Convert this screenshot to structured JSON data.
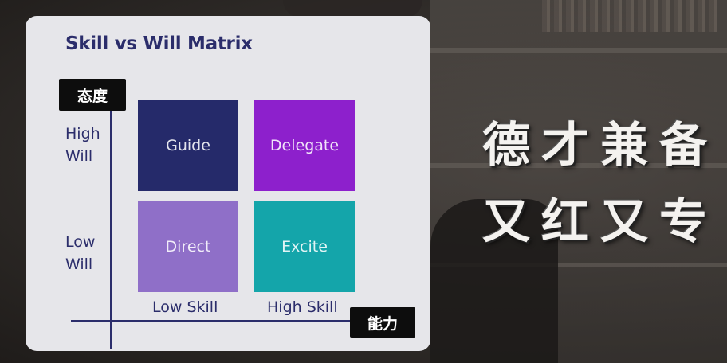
{
  "diagram": {
    "title": "Skill vs Will Matrix",
    "y_axis_tag": "态度",
    "x_axis_tag": "能力",
    "y_labels": {
      "high": "High\nWill",
      "low": "Low\nWill"
    },
    "x_labels": {
      "low": "Low Skill",
      "high": "High Skill"
    },
    "quadrants": {
      "guide": {
        "label": "Guide",
        "color": "#252a6a"
      },
      "delegate": {
        "label": "Delegate",
        "color": "#8d20cc"
      },
      "direct": {
        "label": "Direct",
        "color": "#8f6fc8"
      },
      "excite": {
        "label": "Excite",
        "color": "#14a5aa"
      }
    }
  },
  "overlay": {
    "line1": "德才兼备",
    "line2": "又红又专"
  }
}
